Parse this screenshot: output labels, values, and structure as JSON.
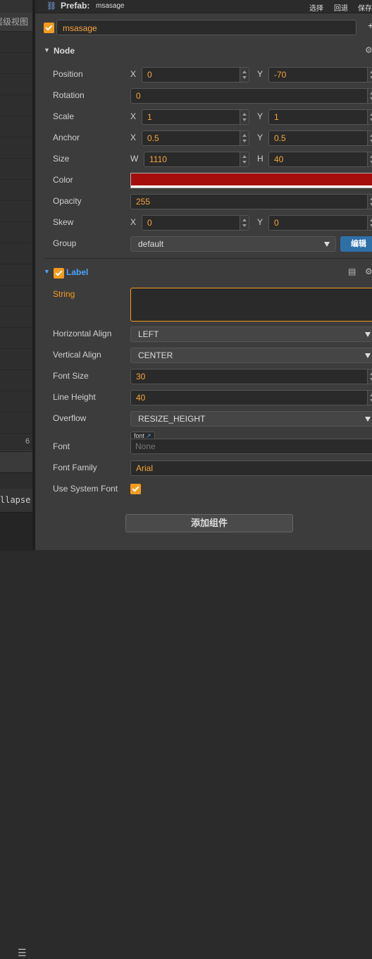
{
  "hierarchy": {
    "title": "层级视图",
    "scroll_number": "6",
    "collapse_text": "llapse"
  },
  "topbar": {
    "prefab_label": "Prefab:",
    "prefab_name": "msasage",
    "btn_select": "选择",
    "btn_revert": "回退",
    "btn_save": "保存"
  },
  "node_name": "msasage",
  "node": {
    "section_label": "Node",
    "position": {
      "label": "Position",
      "x_axis": "X",
      "x": "0",
      "y_axis": "Y",
      "y": "-70"
    },
    "rotation": {
      "label": "Rotation",
      "value": "0"
    },
    "scale": {
      "label": "Scale",
      "x_axis": "X",
      "x": "1",
      "y_axis": "Y",
      "y": "1"
    },
    "anchor": {
      "label": "Anchor",
      "x_axis": "X",
      "x": "0.5",
      "y_axis": "Y",
      "y": "0.5"
    },
    "size": {
      "label": "Size",
      "w_axis": "W",
      "w": "1110",
      "h_axis": "H",
      "h": "40"
    },
    "color": {
      "label": "Color",
      "value": "#a50d0d"
    },
    "opacity": {
      "label": "Opacity",
      "value": "255"
    },
    "skew": {
      "label": "Skew",
      "x_axis": "X",
      "x": "0",
      "y_axis": "Y",
      "y": "0"
    },
    "group": {
      "label": "Group",
      "value": "default",
      "edit_label": "编辑"
    }
  },
  "label_comp": {
    "section_label": "Label",
    "string": {
      "label": "String",
      "value": ""
    },
    "horizontal_align": {
      "label": "Horizontal Align",
      "value": "LEFT"
    },
    "vertical_align": {
      "label": "Vertical Align",
      "value": "CENTER"
    },
    "font_size": {
      "label": "Font Size",
      "value": "30"
    },
    "line_height": {
      "label": "Line Height",
      "value": "40"
    },
    "overflow": {
      "label": "Overflow",
      "value": "RESIZE_HEIGHT"
    },
    "font": {
      "label": "Font",
      "tag": "font",
      "value": "None"
    },
    "font_family": {
      "label": "Font Family",
      "value": "Arial"
    },
    "use_system_font": {
      "label": "Use System Font",
      "checked": true
    }
  },
  "add_component": "添加组件",
  "colors": {
    "accent": "#f39c1f",
    "value_text": "#f5a53b",
    "label_blue": "#4aa3ff",
    "edit_button": "#2f6fa8"
  }
}
